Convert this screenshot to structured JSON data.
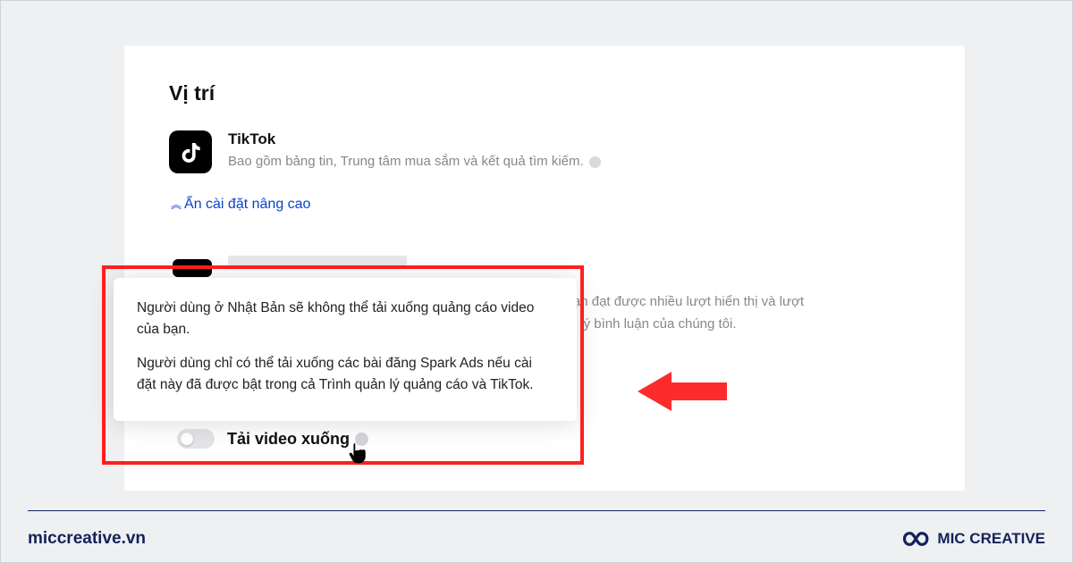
{
  "section": {
    "title": "Vị trí"
  },
  "platform": {
    "name": "TikTok",
    "desc": "Bao gồm bảng tin, Trung tâm mua sắm và kết quả tìm kiếm."
  },
  "collapse_label": "Ẩn cài đặt nâng cao",
  "pangle": {
    "line1": "ng cáo của bạn đạt được nhiều lượt hiển thị và lượt",
    "line2": "công cụ quản lý bình luận của chúng tôi."
  },
  "tooltip": {
    "p1": "Người dùng ở Nhật Bản sẽ không thể tải xuống quảng cáo video của bạn.",
    "p2": "Người dùng chỉ có thể tải xuống các bài đăng Spark Ads nếu cài đặt này đã được bật trong cả Trình quản lý quảng cáo và TikTok."
  },
  "toggle_label": "Tải video xuống",
  "footer": {
    "url": "miccreative.vn",
    "brand": "MIC CREATIVE"
  },
  "colors": {
    "accent_red": "#ff1f1f",
    "link_blue": "#0a43c9",
    "brand_navy": "#14225a"
  }
}
